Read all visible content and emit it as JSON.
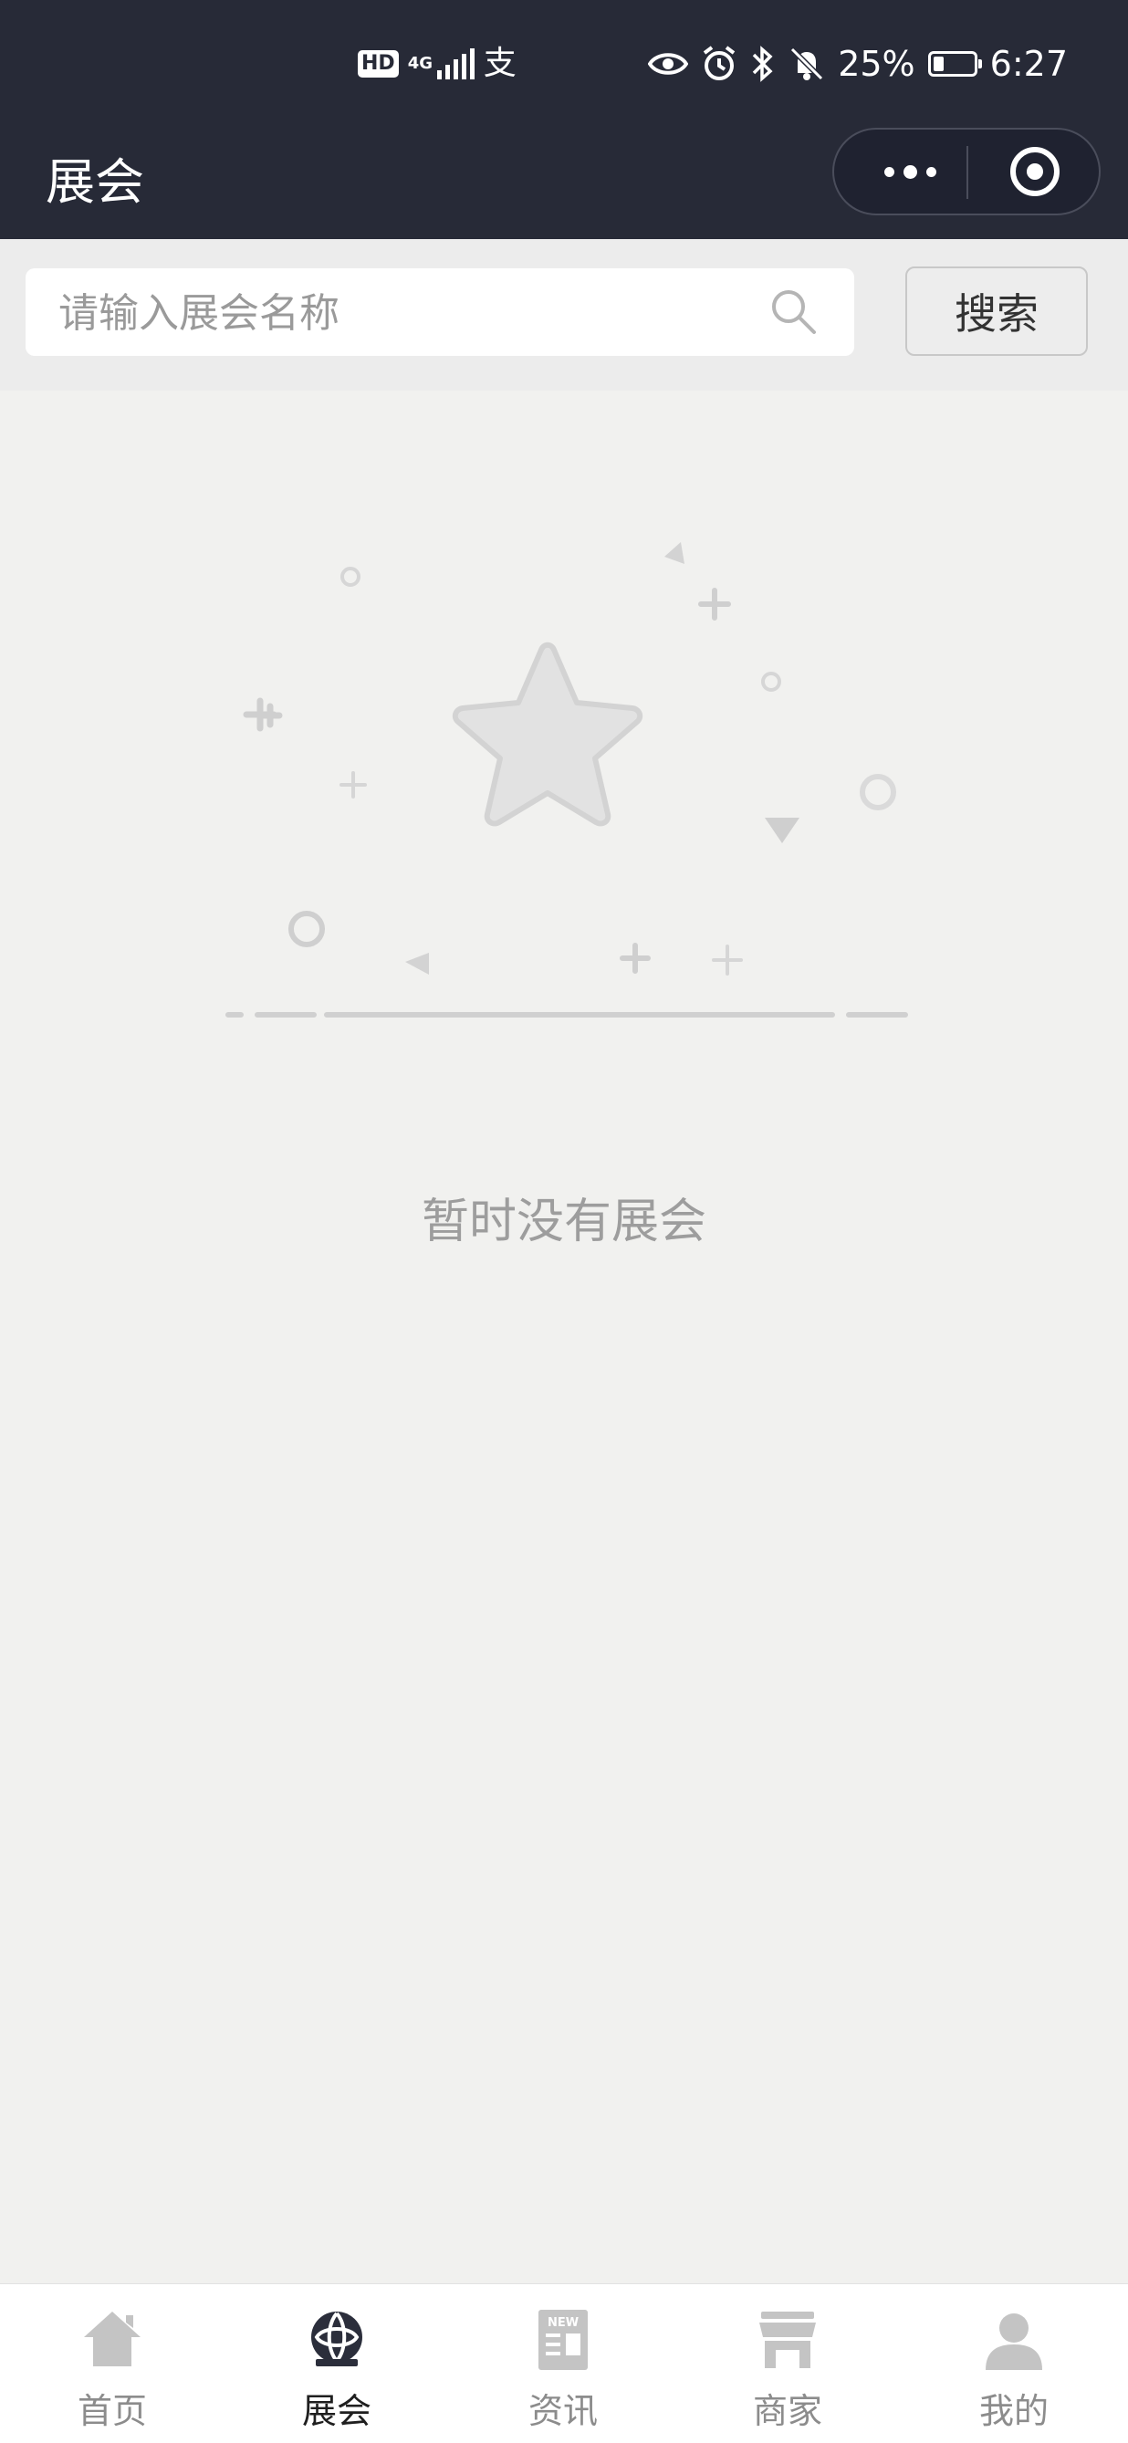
{
  "status_bar": {
    "hd_badge": "HD",
    "network": "4G",
    "extra_glyph": "支",
    "battery_percent": "25%",
    "battery_level": 0.25,
    "time": "6:27"
  },
  "nav": {
    "title": "展会"
  },
  "search": {
    "placeholder": "请输入展会名称",
    "value": "",
    "button_label": "搜索"
  },
  "empty_state": {
    "message": "暂时没有展会"
  },
  "tab_bar": {
    "items": [
      {
        "label": "首页",
        "icon": "home-icon",
        "active": false
      },
      {
        "label": "展会",
        "icon": "exhibition-icon",
        "active": true
      },
      {
        "label": "资讯",
        "icon": "news-icon",
        "active": false
      },
      {
        "label": "商家",
        "icon": "store-icon",
        "active": false
      },
      {
        "label": "我的",
        "icon": "profile-icon",
        "active": false
      }
    ]
  },
  "colors": {
    "header_bg": "#272a37",
    "page_bg": "#f1f1ef",
    "tab_active": "#1f1f1f",
    "tab_inactive": "#8c8c8c"
  }
}
